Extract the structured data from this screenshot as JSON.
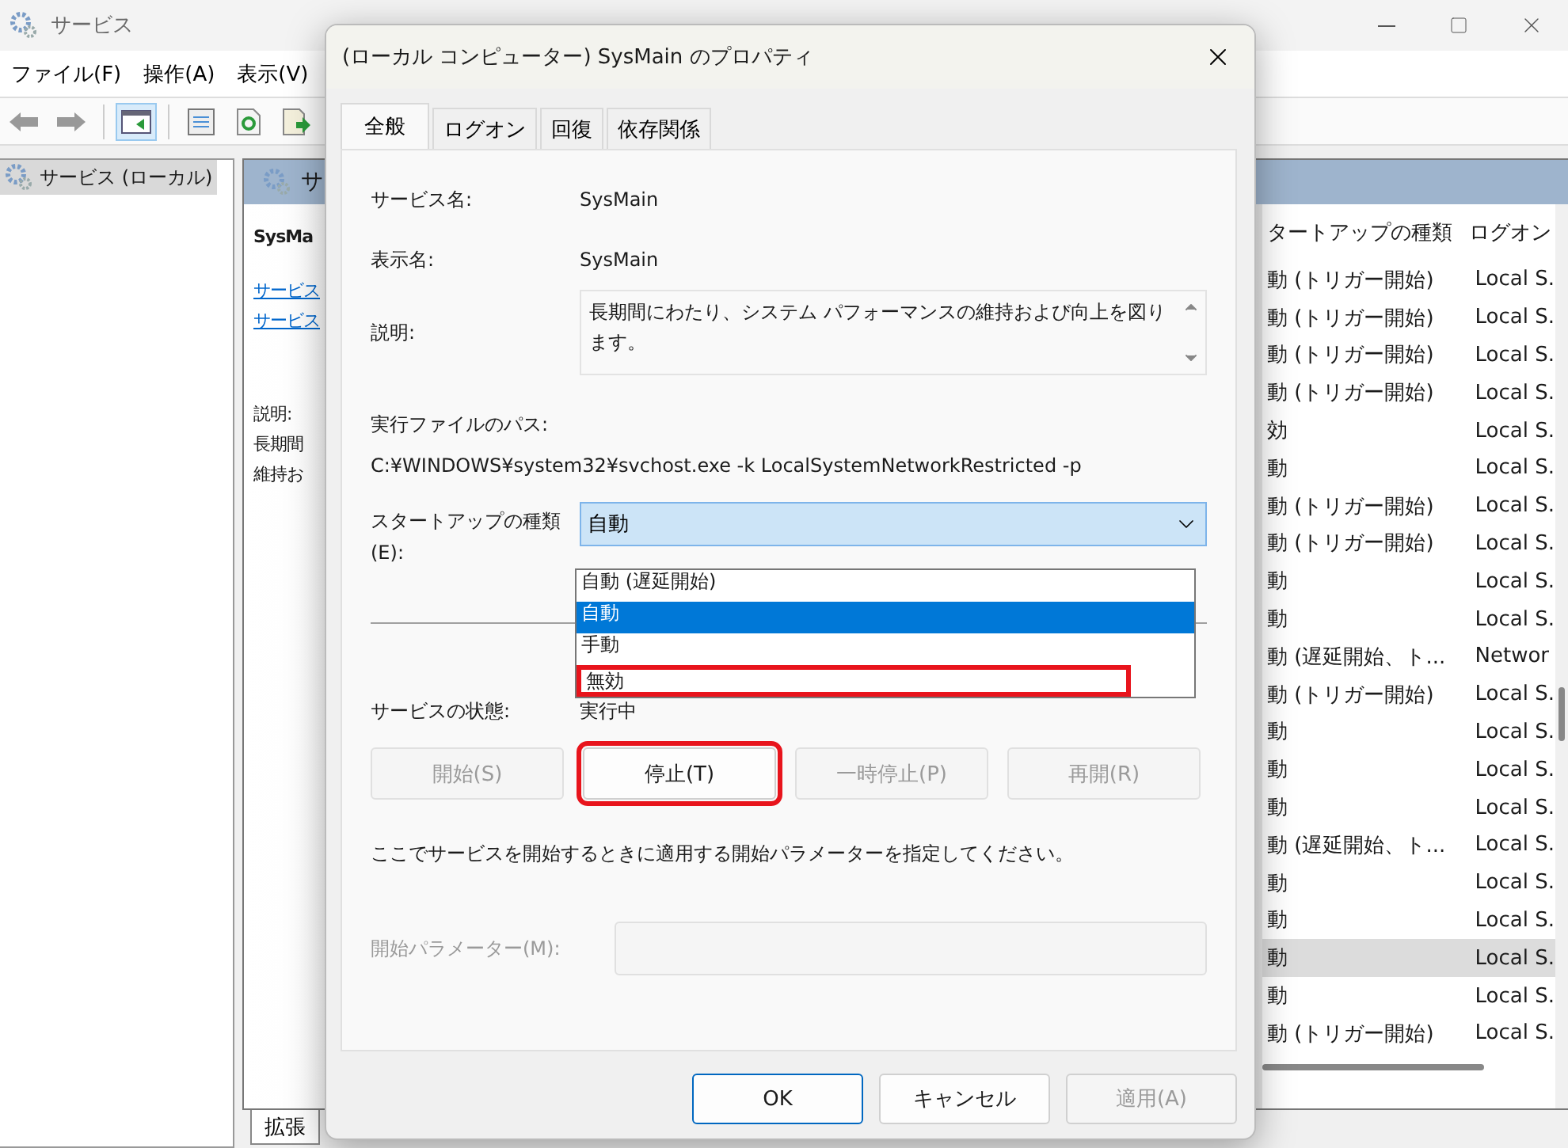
{
  "window": {
    "title": "サービス"
  },
  "menu": [
    "ファイル(F)",
    "操作(A)",
    "表示(V)"
  ],
  "tree": [
    {
      "label": "サービス (ローカル)",
      "selected": true
    }
  ],
  "detail": {
    "header": "サ",
    "name": "SysMa",
    "links": [
      "サービス",
      "サービス"
    ],
    "desc_label": "説明:",
    "desc_lines": [
      "長期間",
      "維持お"
    ]
  },
  "list": {
    "columns": [
      "タートアップの種類",
      "ログオン"
    ],
    "rows": [
      {
        "startup": "動 (トリガー開始)",
        "logon": "Local S.",
        "selected": false
      },
      {
        "startup": "動 (トリガー開始)",
        "logon": "Local S.",
        "selected": false
      },
      {
        "startup": "動 (トリガー開始)",
        "logon": "Local S.",
        "selected": false
      },
      {
        "startup": "動 (トリガー開始)",
        "logon": "Local S.",
        "selected": false
      },
      {
        "startup": "効",
        "logon": "Local S.",
        "selected": false
      },
      {
        "startup": "動",
        "logon": "Local S.",
        "selected": false
      },
      {
        "startup": "動 (トリガー開始)",
        "logon": "Local S.",
        "selected": false
      },
      {
        "startup": "動 (トリガー開始)",
        "logon": "Local S.",
        "selected": false
      },
      {
        "startup": "動",
        "logon": "Local S.",
        "selected": false
      },
      {
        "startup": "動",
        "logon": "Local S.",
        "selected": false
      },
      {
        "startup": "動 (遅延開始、ト...",
        "logon": "Networ",
        "selected": false
      },
      {
        "startup": "動 (トリガー開始)",
        "logon": "Local S.",
        "selected": false
      },
      {
        "startup": "動",
        "logon": "Local S.",
        "selected": false
      },
      {
        "startup": "動",
        "logon": "Local S.",
        "selected": false
      },
      {
        "startup": "動",
        "logon": "Local S.",
        "selected": false
      },
      {
        "startup": "動 (遅延開始、ト...",
        "logon": "Local S.",
        "selected": false
      },
      {
        "startup": "動",
        "logon": "Local S.",
        "selected": false
      },
      {
        "startup": "動",
        "logon": "Local S.",
        "selected": false
      },
      {
        "startup": "動",
        "logon": "Local S.",
        "selected": true
      },
      {
        "startup": "動",
        "logon": "Local S.",
        "selected": false
      },
      {
        "startup": "動 (トリガー開始)",
        "logon": "Local S.",
        "selected": false
      }
    ]
  },
  "bottom_tabs": [
    {
      "label": "拡張",
      "selected": true
    }
  ],
  "dialog": {
    "title": "(ローカル コンピューター) SysMain のプロパティ",
    "tabs": [
      {
        "label": "全般",
        "selected": true
      },
      {
        "label": "ログオン",
        "selected": false
      },
      {
        "label": "回復",
        "selected": false
      },
      {
        "label": "依存関係",
        "selected": false
      }
    ],
    "service_name_label": "サービス名:",
    "service_name": "SysMain",
    "display_name_label": "表示名:",
    "display_name": "SysMain",
    "description_label": "説明:",
    "description": "長期間にわたり、システム パフォーマンスの維持および向上を図ります。",
    "path_label": "実行ファイルのパス:",
    "path": "C:¥WINDOWS¥system32¥svchost.exe -k LocalSystemNetworkRestricted -p",
    "startup_label": "スタートアップの種類(E):",
    "startup_value": "自動",
    "startup_options": [
      {
        "label": "自動 (遅延開始)",
        "selected": false,
        "highlighted": false
      },
      {
        "label": "自動",
        "selected": true,
        "highlighted": false
      },
      {
        "label": "手動",
        "selected": false,
        "highlighted": false
      },
      {
        "label": "無効",
        "selected": false,
        "highlighted": true
      }
    ],
    "status_label": "サービスの状態:",
    "status": "実行中",
    "service_buttons": [
      {
        "label": "開始(S)",
        "disabled": true,
        "highlighted": false
      },
      {
        "label": "停止(T)",
        "disabled": false,
        "highlighted": true
      },
      {
        "label": "一時停止(P)",
        "disabled": true,
        "highlighted": false
      },
      {
        "label": "再開(R)",
        "disabled": true,
        "highlighted": false
      }
    ],
    "hint": "ここでサービスを開始するときに適用する開始パラメーターを指定してください。",
    "param_label": "開始パラメーター(M):",
    "param_disabled": true,
    "buttons": [
      {
        "label": "OK",
        "disabled": false,
        "default": true
      },
      {
        "label": "キャンセル",
        "disabled": false,
        "default": false
      },
      {
        "label": "適用(A)",
        "disabled": true,
        "default": false
      }
    ]
  }
}
